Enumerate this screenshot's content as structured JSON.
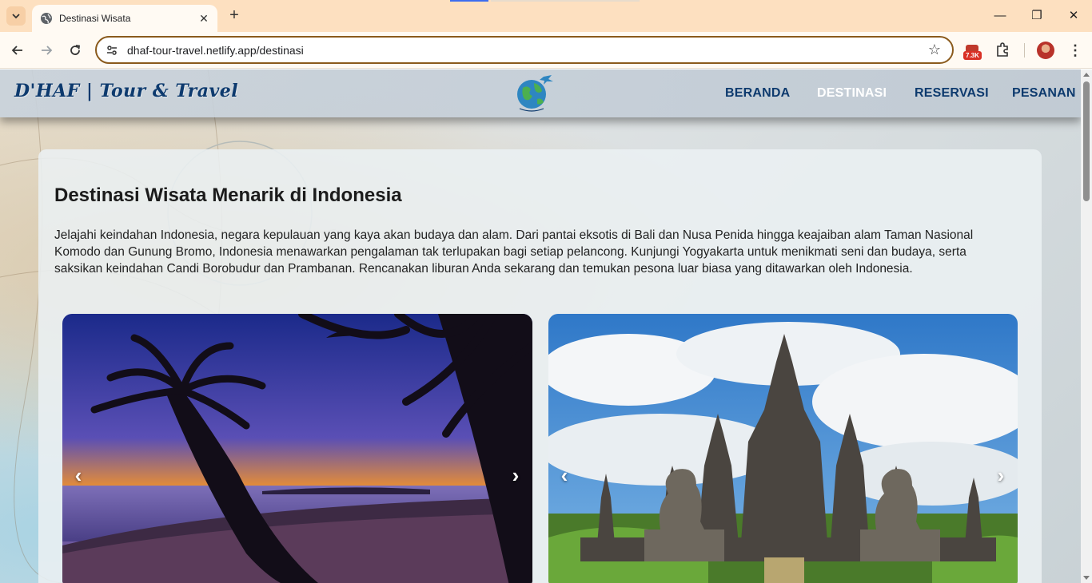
{
  "browser": {
    "tab": {
      "title": "Destinasi Wisata",
      "close": "✕",
      "icon": "globe-icon"
    },
    "new_tab": "+",
    "window_controls": {
      "minimize": "—",
      "restore": "❐",
      "close": "✕"
    },
    "address_bar": {
      "url": "dhaf-tour-travel.netlify.app/destinasi"
    },
    "bookmark": "☆",
    "extension_badge": "7.3K",
    "menu": "⋮"
  },
  "site": {
    "brand": "D'HAF | Tour & Travel",
    "nav": [
      {
        "label": "BERANDA",
        "active": false
      },
      {
        "label": "DESTINASI",
        "active": true
      },
      {
        "label": "RESERVASI",
        "active": false
      },
      {
        "label": "PESANAN",
        "active": false
      }
    ],
    "title": "Destinasi Wisata Menarik di Indonesia",
    "intro": "Jelajahi keindahan Indonesia, negara kepulauan yang kaya akan budaya dan alam. Dari pantai eksotis di Bali dan Nusa Penida hingga keajaiban alam Taman Nasional Komodo dan Gunung Bromo, Indonesia menawarkan pengalaman tak terlupakan bagi setiap pelancong. Kunjungi Yogyakarta untuk menikmati seni dan budaya, serta saksikan keindahan Candi Borobudur dan Prambanan. Rencanakan liburan Anda sekarang dan temukan pesona luar biasa yang ditawarkan oleh Indonesia.",
    "carousel": {
      "prev": "‹",
      "next": "›"
    }
  },
  "colors": {
    "brand_navy": "#0d3a6e",
    "address_border": "#8a5a1c",
    "tabbar": "#fde0c0"
  }
}
